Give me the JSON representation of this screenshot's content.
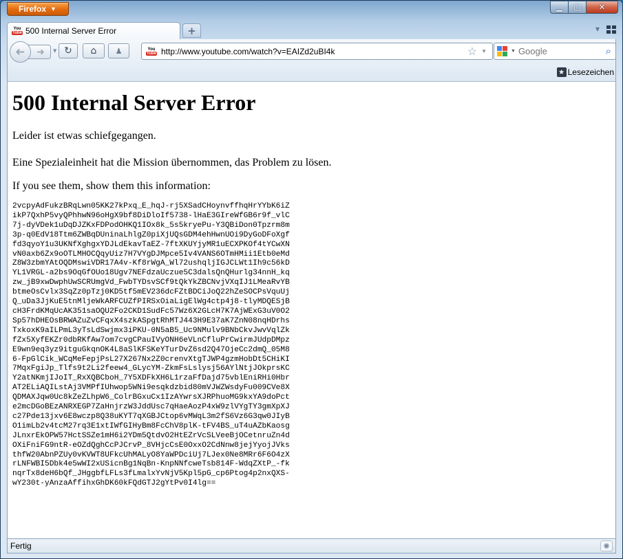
{
  "window": {
    "firefox_button_label": "Firefox",
    "controls": {
      "minimize": "▁",
      "maximize": "□",
      "close": "✕"
    }
  },
  "tabs": {
    "active_tab_title": "500 Internal Server Error",
    "active_tab_favicon": "youtube-icon",
    "new_tab_label": "+"
  },
  "navbar": {
    "url": "http://www.youtube.com/watch?v=EAIZd2uBI4k",
    "site_icon": "youtube-icon",
    "search_placeholder": "Google",
    "search_engine_icon": "google-icon"
  },
  "bookmarks_bar": {
    "bookmarks_label": "Lesezeichen"
  },
  "page": {
    "heading": "500 Internal Server Error",
    "paragraph1": "Leider ist etwas schiefgegangen.",
    "paragraph2": "Eine Spezialeinheit hat die Mission übernommen, das Problem zu lösen.",
    "paragraph3": "If you see them, show them this information:",
    "error_code": "2vcpyAdFukzBRqLwn05KK27kPxq_E_hqJ-rj5XSadCHoynvffhqHrYYbK6iZ\nikP7QxhP5vyQPhhwN96oHgX9bf8DiDloIf5738-lHaE3GIreWfGB6r9f_vlC\n7j-dyVDek1uDqDJZKxFDPodOHKQ1IOx8k_5s5kryePu-Y3QBiDon0Tpzrm8m\n3p-q0EdV18Ttm6ZWBqDUninaLhlgZ0piXjUQsGDM4ehHwnUOi9DyGoDFoXgf\nfd3qyoY1u3UKNfXghgxYDJLdEkavTaEZ-7ftXKUYjyMR1uECXPKOf4tYCwXN\nvN0axb6Zx9oOTLMHOCQqyUiz7H7VYgDJMpce5Iv4VANS6OTmHMii1Etb0eMd\nZ8W3zbmYAtOQDMswiVDR17A4v-Kf8rWgA_Wl72ushqljIGJCLWt1Ih9c56kD\nYL1VRGL-a2bs9OqGfOUo18Ugv7NEFdzaUczue5C3dalsQnQHurlg34nnH_kq\nzw_jB9xwDwphUwSCRUmgVd_FwbTYDsvSCf9tQkYkZBCNvjVXqIJ1LMeaRvYB\nbtmeOsCvlx3SqZz0pTzj0KD5tf5mEV236dcFZtBDCiJoQ22hZeSOCPsVquUj\nQ_uDa3JjKuE5tnMljeWkARFCUZfPIRSxOiaLigElWg4ctp4j8-tlyMDQESjB\ncH3FrdKMqUcAK351saOQU2Fo2CKD1SudFc57Wz6X2GLcH7K7AjWExG3uV0O2\nSp57hDHEOsBRWAZuZvCFqxX4szkASpgtRhMTJ443H9E37aK7ZnN08nqHDrhs\nTxkoxK9aILPmL3yTsLdSwjmx3iPKU-0N5aB5_Uc9NMulv9BNbCkvJwvVqlZk\nfZx5XyfEKZr0dbRKfAw7om7cvgCPauIVyONH6eVLnCfluPrCwirmJUdpDMpz\nE9wn9eq3yz9itguGkqnOK4L8aSlKFSKeYTurDvZ6sd2Q47OjeCc2dmQ_05M8\n6-FpGlCik_WCqMeFepjPsL27X267Nx2Z0crenvXtgTJWP4gzmHobDt5CHiKI\n7MqxFgiJp_Tlfs9t2Li2feew4_GLycYM-ZkmFsLslysj56AYlNtjJOkprsKC\nY2atNKmjIJoIT_RxXQBCboH_7Y5XDFkXH6L1rzaFfDajd75vblEniRHi0Hbr\nAT2ELiAQILstAj3VMPfIUhwop5WNi9esqkdzbid80mVJWZWsdyFu009CVe8X\nQDMAXJqw0Uc8kZeZLhpW6_ColrBGxuCx1IzAYwrsXJRPhuoMG9kxYA9doPct\ne2mcDGoBEzANRXEGP7ZaHnjrzW3JddUsc7qHaeAozP4xW9zlVYgTY3gmXpXJ\nc27Pde13jxv6E8wczp8Q38uKYT7qXGBJCtop6vMWqL3m2fS6Vz6G3qw0JIyB\nO1imLb2v4tcM27rq3E1xtIWfGIHyBm8FcChV8plK-tFV4BS_uT4uAZbKaosg\nJLnxrEkOPW57HctSSZe1mH6i2YDm5QtdvO2HtEZrVcSLVeeBjOCetnruZn4d\nOXiFniFG9ntR-eOZdQghCcPJCrvP_8VHjcCsE0OxxO2CdNnw8jejYyojJVks\nthfW20AbnPZUy0vKVWT8UFkcUhMALyO8YaWPDciUj7LJex0Ne8MRr6F6O4zX\nrLNFWBI5Dbk4e5wWI2xUSicnBg1NqBn-KnpNNfcweTsb814F-WdqZXtP_-fk\nnqrTx8deH6bQf_JHggbfLFLs3fLmalxYvNjV5Kpl5pG_cp6Ptog4p2nxQXS-\nwY230t-yAnzaAffihxGhDK60kFQdGTJ2gYtPv0I4lg=="
  },
  "statusbar": {
    "status_text": "Fertig"
  }
}
